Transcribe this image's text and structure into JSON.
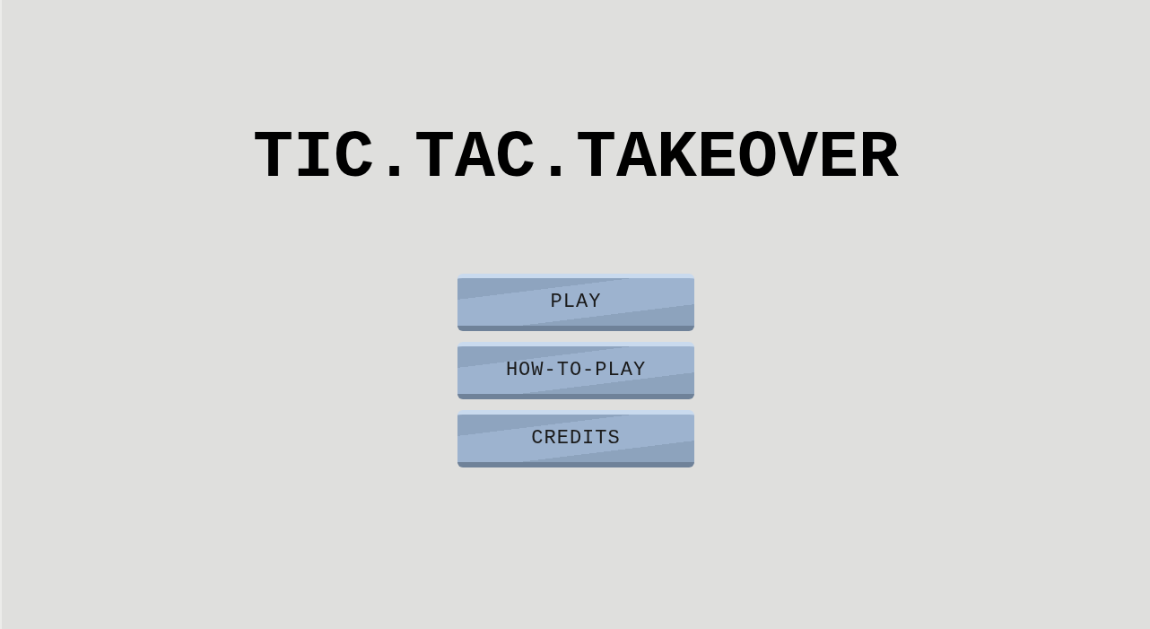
{
  "title": "TIC.TAC.TAKEOVER",
  "menu": [
    {
      "label": "PLAY"
    },
    {
      "label": "HOW-TO-PLAY"
    },
    {
      "label": "CREDITS"
    }
  ]
}
